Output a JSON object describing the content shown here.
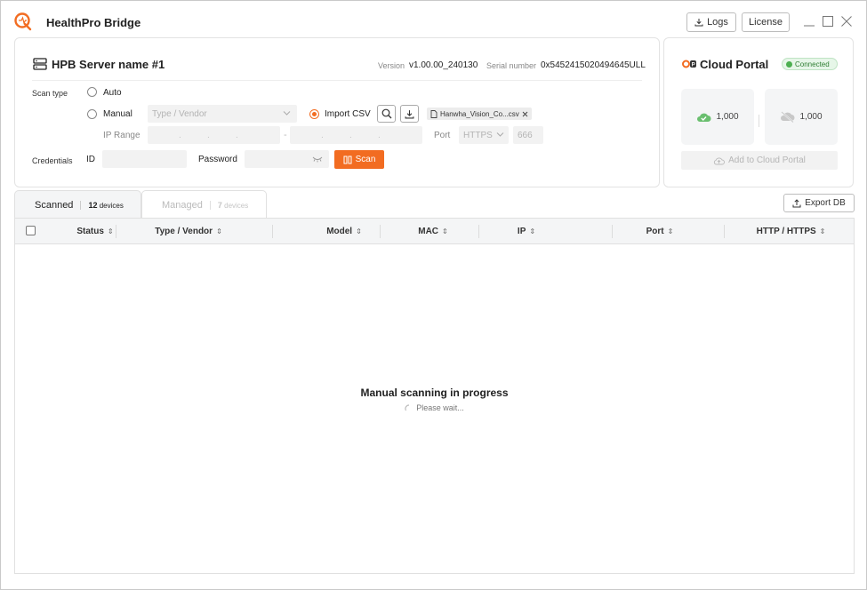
{
  "app": {
    "title": "HealthPro Bridge",
    "accent_color": "#f26c21"
  },
  "titlebar": {
    "logs_label": "Logs",
    "license_label": "License"
  },
  "server": {
    "name": "HPB Server name #1",
    "version_label": "Version",
    "version_value": "v1.00.00_240130",
    "serial_label": "Serial number",
    "serial_value": "0x5452415020494645ULL"
  },
  "scan": {
    "scan_type_label": "Scan type",
    "auto_label": "Auto",
    "manual_label": "Manual",
    "type_vendor_placeholder": "Type / Vendor",
    "import_csv_label": "Import CSV",
    "csv_file": "Hanwha_Vision_Co...csv",
    "ip_range_label": "IP Range",
    "port_label": "Port",
    "port_protocol": "HTTPS",
    "port_value": "666",
    "credentials_label": "Credentials",
    "id_label": "ID",
    "password_label": "Password",
    "scan_button": "Scan",
    "selected_type": "import_csv"
  },
  "cloud": {
    "title": "Cloud Portal",
    "status": "Connected",
    "connected_count": "1,000",
    "disconnected_count": "1,000",
    "add_button": "Add to Cloud Portal"
  },
  "tabs": [
    {
      "label": "Scanned",
      "count": "12",
      "unit": "devices",
      "active": true
    },
    {
      "label": "Managed",
      "count": "7",
      "unit": "devices",
      "active": false
    }
  ],
  "export_label": "Export DB",
  "table": {
    "columns": [
      "Status",
      "Type / Vendor",
      "Model",
      "MAC",
      "IP",
      "Port",
      "HTTP / HTTPS"
    ]
  },
  "progress": {
    "title": "Manual scanning in progress",
    "subtitle": "Please wait..."
  }
}
